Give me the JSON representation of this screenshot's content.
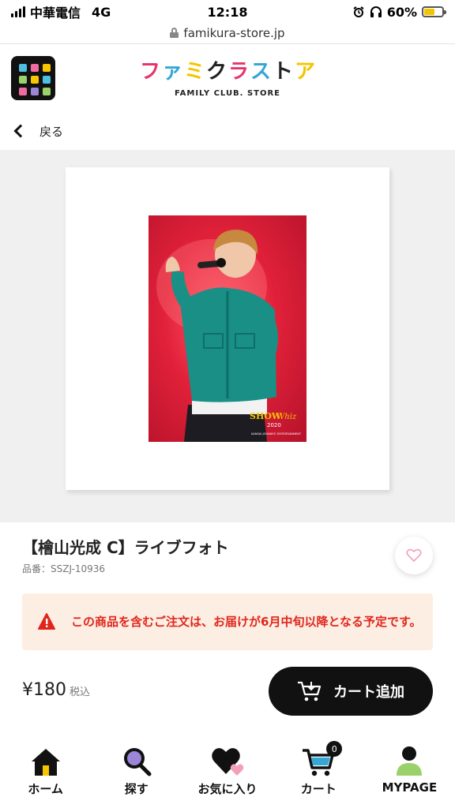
{
  "status_bar": {
    "carrier": "中華電信",
    "network": "4G",
    "time": "12:18",
    "battery": "60%",
    "battery_level": 0.6
  },
  "url_bar": {
    "url": "famikura-store.jp"
  },
  "header": {
    "logo_jp_chars": [
      "フ",
      "ァ",
      "ミ",
      "ク",
      "ラ",
      "ス",
      "ト",
      "ア"
    ],
    "logo_jp_colors": [
      "#e8346c",
      "#34a7d6",
      "#f5c400",
      "#222222",
      "#e8346c",
      "#34a7d6",
      "#222222",
      "#f5c400"
    ],
    "logo_en": "FAMILY CLUB. STORE",
    "menu_colors": [
      "#4cc0e0",
      "#f06ca0",
      "#f7c600",
      "#9ad16a",
      "#f7c600",
      "#4cc0e0",
      "#f06ca0",
      "#9b86d8",
      "#9ad16a"
    ]
  },
  "back": {
    "label": "戻る"
  },
  "photo": {
    "caption_title": "SHOW",
    "caption_title_2": "Whiz",
    "caption_year": "2020",
    "caption_sub": "KANSAI JOHNNYS' ENTERTAINMENT"
  },
  "product": {
    "title": "【檜山光成 C】ライブフォト",
    "code": "品番：SSZJ-10936",
    "notice": "この商品を含むご注文は、お届けが6月中旬以降となる予定です。",
    "price": "¥180",
    "tax": "税込",
    "cart_button": "カート追加"
  },
  "nav": {
    "items": [
      {
        "label": "ホーム",
        "icon": "home-icon"
      },
      {
        "label": "探す",
        "icon": "search-icon"
      },
      {
        "label": "お気に入り",
        "icon": "favorites-icon"
      },
      {
        "label": "カート",
        "icon": "cart-icon"
      },
      {
        "label": "MYPAGE",
        "icon": "user-icon"
      }
    ],
    "cart_count": "0"
  },
  "colors": {
    "warning": "#e0261c",
    "notice_bg": "#fdeee3",
    "favorite_pink": "#f2a0b8",
    "accent_yellow": "#f5c400",
    "accent_purple": "#9b86d8",
    "accent_green": "#9ad16a",
    "accent_blue": "#34a7d6"
  }
}
